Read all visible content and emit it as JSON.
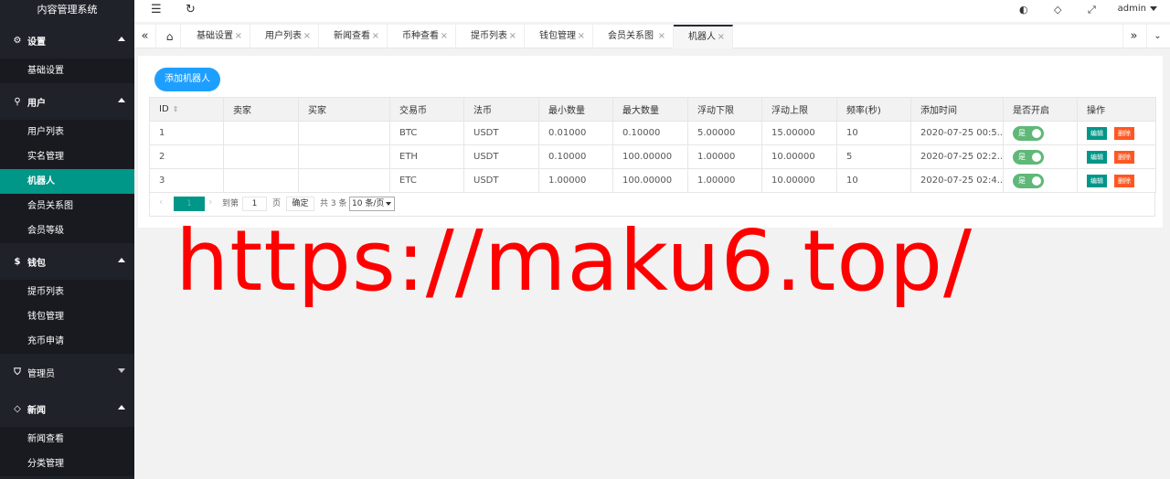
{
  "app": {
    "title": "内容管理系统"
  },
  "sidebar": {
    "groups": [
      {
        "label": "设置",
        "icon": "gear-icon",
        "expanded": true,
        "items": [
          "基础设置"
        ]
      },
      {
        "label": "用户",
        "icon": "user-icon",
        "expanded": true,
        "items": [
          "用户列表",
          "实名管理",
          "机器人",
          "会员关系图",
          "会员等级"
        ]
      },
      {
        "label": "钱包",
        "icon": "dollar-icon",
        "expanded": true,
        "items": [
          "提币列表",
          "钱包管理",
          "充币申请"
        ]
      },
      {
        "label": "管理员",
        "icon": "shield-icon",
        "expanded": false,
        "items": []
      },
      {
        "label": "新闻",
        "icon": "tag-icon",
        "expanded": true,
        "items": [
          "新闻查看",
          "分类管理"
        ]
      }
    ],
    "active_item": "机器人"
  },
  "header": {
    "user": "admin"
  },
  "tabs": [
    "基础设置",
    "用户列表",
    "新闻查看",
    "币种查看",
    "提币列表",
    "钱包管理",
    "会员关系图",
    "机器人"
  ],
  "toolbar": {
    "add_label": "添加机器人"
  },
  "table": {
    "columns": [
      "ID",
      "卖家",
      "买家",
      "交易币",
      "法币",
      "最小数量",
      "最大数量",
      "浮动下限",
      "浮动上限",
      "频率(秒)",
      "添加时间",
      "是否开启",
      "操作"
    ],
    "rows": [
      [
        "1",
        "",
        "",
        "BTC",
        "USDT",
        "0.01000",
        "0.10000",
        "5.00000",
        "15.00000",
        "10",
        "2020-07-25 00:5..."
      ],
      [
        "2",
        "",
        "",
        "ETH",
        "USDT",
        "0.10000",
        "100.00000",
        "1.00000",
        "10.00000",
        "5",
        "2020-07-25 02:2..."
      ],
      [
        "3",
        "",
        "",
        "ETC",
        "USDT",
        "1.00000",
        "100.00000",
        "1.00000",
        "10.00000",
        "10",
        "2020-07-25 02:4..."
      ]
    ],
    "switch_label": "是",
    "edit_label": "编辑",
    "delete_label": "删除"
  },
  "pager": {
    "current": "1",
    "goto_label": "到第",
    "page_input": "1",
    "page_unit": "页",
    "ok_label": "确定",
    "total": "共 3 条",
    "size": "10 条/页"
  },
  "watermark": "https://maku6.top/",
  "colors": {
    "sidebar": "#20222a",
    "active": "#009688",
    "primary": "#1e9fff",
    "switch": "#5fb878",
    "danger": "#ff5722",
    "watermark": "#ff0000"
  }
}
